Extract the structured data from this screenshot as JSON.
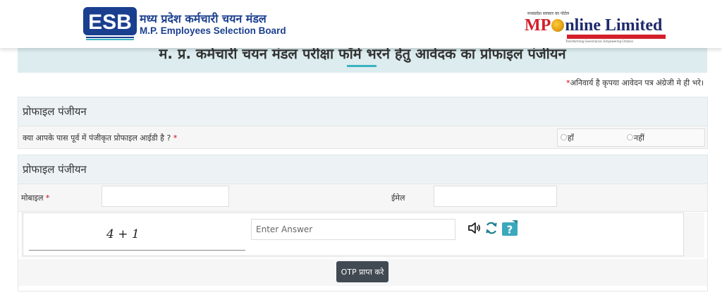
{
  "header": {
    "esb_logo_letters": "ESB",
    "esb_name_hindi": "मध्य प्रदेश कर्मचारी चयन मंडल",
    "esb_name_english": "M.P. Employees Selection Board",
    "mponline_tagline": "मध्यप्रदेश सरकार का पोर्टल",
    "mponline_name_mp": "MP",
    "mponline_name_rest": "nline Limited",
    "mponline_strip_text": "Transforming Governance, Empowering Citizens"
  },
  "banner": {
    "title": "म. प्र. कर्मचारी चयन मंडल परीक्षा फॉर्म भरने हेतु आवेदक का प्रोफाइल पंजीयन"
  },
  "notice": {
    "star": "*",
    "text": "अनिवार्य है कृपया आवेदन पत्र अंग्रेजी मे ही भरे।"
  },
  "profile_check": {
    "heading": "प्रोफाइल पंजीयन",
    "question": "क्या आपके पास पूर्व में पंजीकृत प्रोफाइल आईडी है ?",
    "required_star": "*",
    "option_yes": "हाँ",
    "option_no": "नहीं"
  },
  "registration": {
    "heading": "प्रोफाइल पंजीयन",
    "mobile_label": "मोबाइल",
    "required_star": "*",
    "email_label": "ईमेल",
    "mobile_value": "",
    "email_value": "",
    "captcha_text": "4 + 1",
    "answer_placeholder": "Enter Answer",
    "otp_button": "OTP प्राप्त करे"
  },
  "colors": {
    "banner_bg": "#dcecef",
    "accent_teal": "#3bb3c3",
    "esb_blue": "#1b3f8f",
    "button_dark": "#414a52",
    "required_red": "#d0021b"
  },
  "icons": [
    "speaker-icon",
    "refresh-icon",
    "help-icon"
  ]
}
